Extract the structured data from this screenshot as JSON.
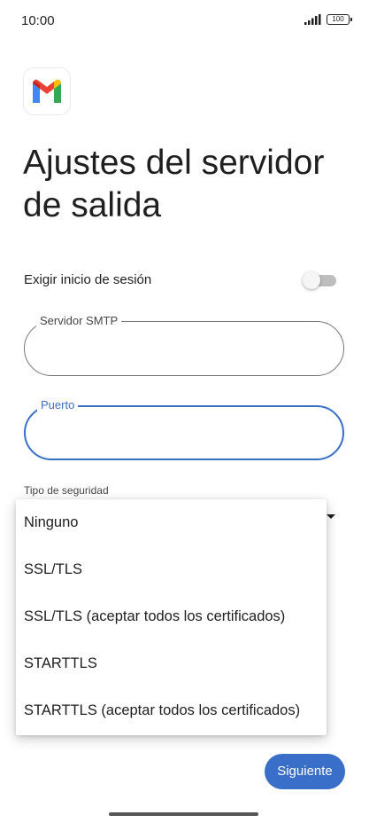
{
  "status_bar": {
    "time": "10:00",
    "battery": "100"
  },
  "app": {
    "logo_icon": "gmail-logo-icon",
    "title": "Ajustes del servidor de salida"
  },
  "login": {
    "label": "Exigir inicio de sesión",
    "enabled": false
  },
  "fields": {
    "smtp": {
      "label": "Servidor SMTP",
      "value": ""
    },
    "port": {
      "label": "Puerto",
      "value": ""
    }
  },
  "security": {
    "label": "Tipo de seguridad",
    "options": [
      "Ninguno",
      "SSL/TLS",
      "SSL/TLS (aceptar todos los certificados)",
      "STARTTLS",
      "STARTTLS (aceptar todos los certificados)"
    ]
  },
  "actions": {
    "next_label": "Siguiente"
  },
  "colors": {
    "accent": "#3a6fc9",
    "text": "#1f1f1f",
    "outline": "#747775",
    "gmail_red": "#ea4335",
    "gmail_blue": "#4285f4",
    "gmail_green": "#34a853",
    "gmail_yellow": "#fbbc04"
  }
}
